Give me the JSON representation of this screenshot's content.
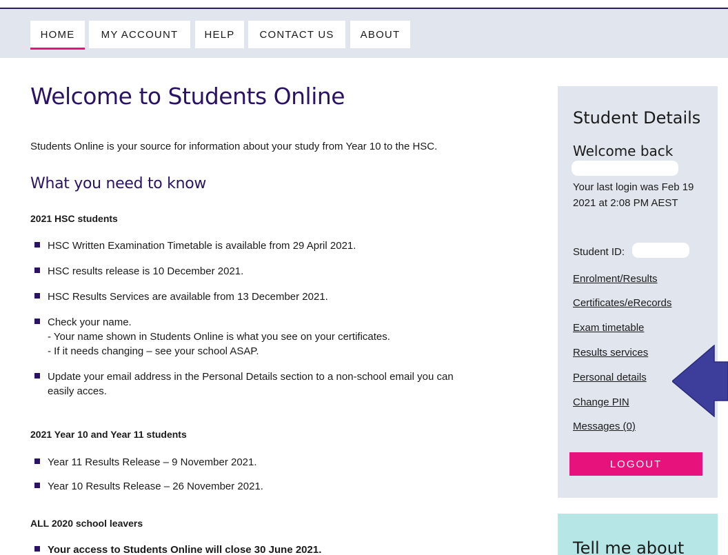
{
  "nav": {
    "items": [
      {
        "label": "HOME",
        "active": true
      },
      {
        "label": "MY ACCOUNT"
      },
      {
        "label": "HELP"
      },
      {
        "label": "CONTACT US"
      },
      {
        "label": "ABOUT"
      }
    ]
  },
  "main": {
    "title": "Welcome to Students Online",
    "intro": "Students Online is your source for information about your study from Year 10 to the HSC.",
    "subheading": "What you need to know",
    "sections": [
      {
        "heading": "2021 HSC students",
        "bullets": [
          "HSC Written Examination Timetable is available from 29 April 2021.",
          "HSC results release is 10 December 2021.",
          "HSC Results Services are available from 13 December 2021.",
          "Check your name.",
          "- Your name shown in Students Online is what you see on your certificates.",
          "- If it needs changing – see your school ASAP.",
          "Update your email address in the Personal Details section to a non-school email you can",
          "easily acces."
        ]
      },
      {
        "heading": "2021 Year 10 and Year 11 students",
        "bullets": [
          "Year 11 Results Release – 9 November 2021.",
          "Year 10 Results Release – 26 November 2021."
        ]
      },
      {
        "heading": "ALL 2020 school leavers",
        "bullets": [
          "Your access to Students Online will close 30 June 2021."
        ]
      }
    ]
  },
  "sidebar": {
    "title": "Student Details",
    "welcome": "Welcome back",
    "last_login": "Your last login was Feb 19 2021 at 2:08 PM AEST",
    "student_id_label": "Student ID:",
    "links": [
      "Enrolment/Results",
      "Certificates/eRecords",
      "Exam timetable",
      "Results services",
      "Personal details",
      "Change PIN",
      "Messages (0)"
    ],
    "logout_label": "LOGOUT"
  },
  "tellbox": {
    "title": "Tell me about"
  },
  "colors": {
    "brand_purple": "#2a1265",
    "accent_pink": "#e8127c",
    "panel_gray": "#e1e6ee",
    "panel_teal": "#b6e6e6",
    "arrow_blue": "#3d3d9c"
  }
}
